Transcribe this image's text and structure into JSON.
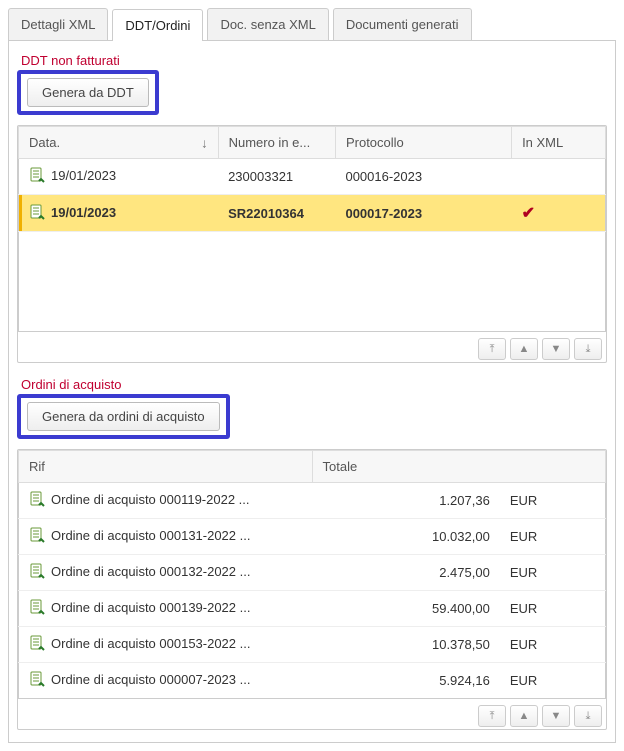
{
  "tabs": {
    "dettagli": "Dettagli XML",
    "ddt": "DDT/Ordini",
    "docsenza": "Doc. senza XML",
    "generati": "Documenti generati"
  },
  "ddt": {
    "title": "DDT non fatturati",
    "button": "Genera da DDT",
    "headers": {
      "data": "Data.",
      "numero": "Numero in e...",
      "protocollo": "Protocollo",
      "inxml": "In XML"
    },
    "rows": [
      {
        "data": "19/01/2023",
        "numero": "230003321",
        "protocollo": "000016-2023",
        "inxml": false,
        "selected": false
      },
      {
        "data": "19/01/2023",
        "numero": "SR22010364",
        "protocollo": "000017-2023",
        "inxml": true,
        "selected": true
      }
    ]
  },
  "ordini": {
    "title": "Ordini di acquisto",
    "button": "Genera da ordini di acquisto",
    "headers": {
      "rif": "Rif",
      "totale": "Totale"
    },
    "currency": "EUR",
    "rows": [
      {
        "rif": "Ordine di acquisto 000119-2022 ...",
        "totale": "1.207,36"
      },
      {
        "rif": "Ordine di acquisto 000131-2022 ...",
        "totale": "10.032,00"
      },
      {
        "rif": "Ordine di acquisto 000132-2022 ...",
        "totale": "2.475,00"
      },
      {
        "rif": "Ordine di acquisto 000139-2022 ...",
        "totale": "59.400,00"
      },
      {
        "rif": "Ordine di acquisto 000153-2022 ...",
        "totale": "10.378,50"
      },
      {
        "rif": "Ordine di acquisto 000007-2023 ...",
        "totale": "5.924,16"
      }
    ]
  }
}
